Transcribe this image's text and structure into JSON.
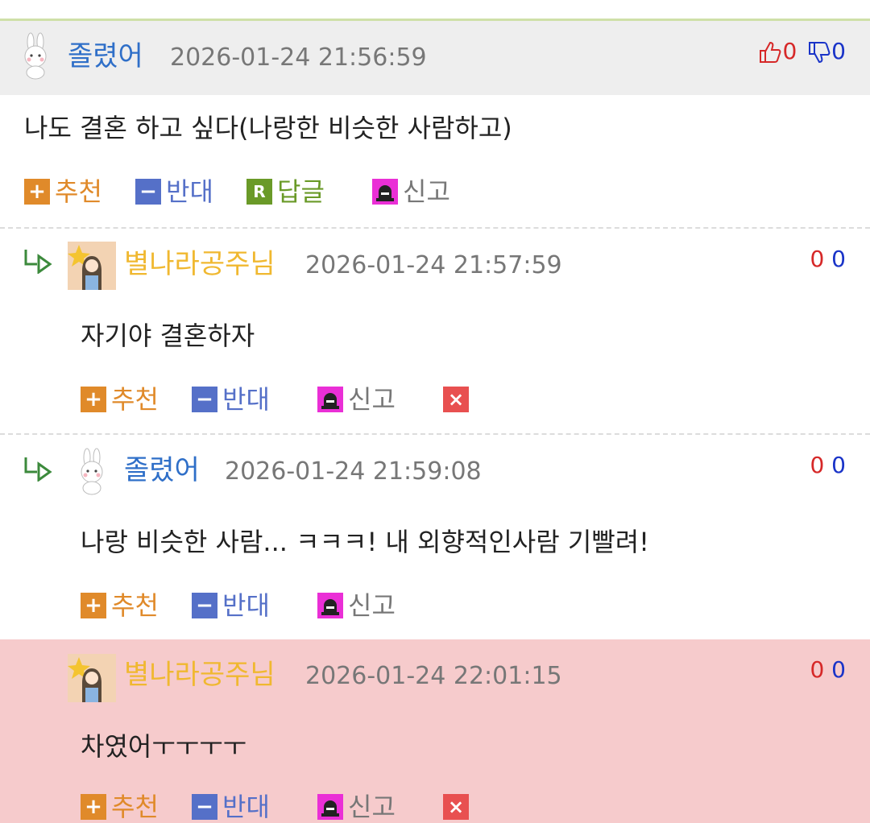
{
  "comments": [
    {
      "nickname": "졸렸어",
      "datetime": "2026-01-24 21:56:59",
      "text": "나도 결혼 하고 싶다(나랑한 비슷한 사람하고)",
      "votes": {
        "up": "0",
        "down": "0"
      },
      "actions": {
        "recommend": "추천",
        "oppose": "반대",
        "reply": "답글",
        "report": "신고"
      }
    },
    {
      "nickname": "별나라공주님",
      "datetime": "2026-01-24 21:57:59",
      "text": "자기야 결혼하자",
      "votes": {
        "up": "0",
        "down": "0"
      },
      "actions": {
        "recommend": "추천",
        "oppose": "반대",
        "report": "신고"
      }
    },
    {
      "nickname": "졸렸어",
      "datetime": "2026-01-24 21:59:08",
      "text": "나랑 비슷한 사람... ㅋㅋㅋ! 내 외향적인사람 기빨려!",
      "votes": {
        "up": "0",
        "down": "0"
      },
      "actions": {
        "recommend": "추천",
        "oppose": "반대",
        "report": "신고"
      }
    },
    {
      "nickname": "별나라공주님",
      "datetime": "2026-01-24 22:01:15",
      "text": "차였어ㅜㅜㅜㅜ",
      "votes": {
        "up": "0",
        "down": "0"
      },
      "actions": {
        "recommend": "추천",
        "oppose": "반대",
        "report": "신고"
      }
    }
  ],
  "colors": {
    "nick_blue": "#2f6fc8",
    "nick_gold": "#f0b830",
    "vote_up": "#d62828",
    "vote_down": "#1a34c8",
    "highlight_bg": "#f6cbcc",
    "header_bg": "#eeeeee"
  },
  "icons": [
    "bunny-avatar",
    "princess-avatar",
    "reply-arrow-icon",
    "thumbs-up-icon",
    "thumbs-down-icon",
    "plus-icon",
    "minus-icon",
    "reply-r-icon",
    "siren-icon",
    "close-icon"
  ]
}
